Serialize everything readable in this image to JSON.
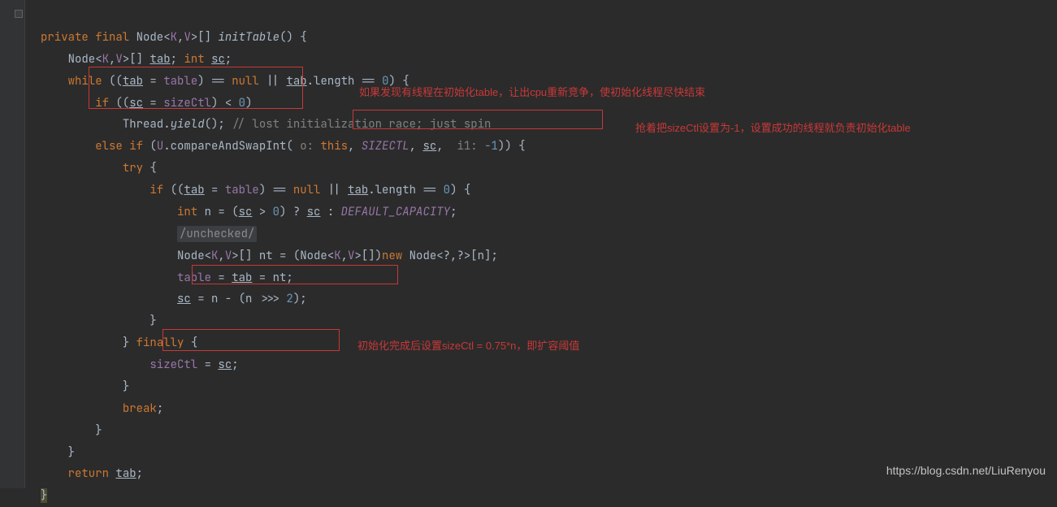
{
  "code": {
    "l1_kw1": "private final",
    "l1_type": "Node",
    "l1_gen": "<K,V>[]",
    "l1_name": "initTable",
    "l1_brace": "() {",
    "l2_a": "Node<",
    "l2_k": "K",
    "l2_m": ",",
    "l2_v": "V",
    "l2_b": ">[] ",
    "l2_tab": "tab",
    "l2_sep": "; ",
    "l2_int": "int ",
    "l2_sc": "sc",
    "l2_end": ";",
    "l3_a": "while ((",
    "l3_tab": "tab",
    "l3_eq": " = ",
    "l3_table": "table",
    "l3_b": ") == ",
    "l3_null": "null",
    "l3_c": " || ",
    "l3_tab2": "tab",
    "l3_len": ".length == ",
    "l3_zero": "0",
    "l3_d": ") {",
    "l4_if": "if ((",
    "l4_sc": "sc",
    "l4_eq": " = ",
    "l4_sctl": "sizeCtl",
    "l4_b": ") < ",
    "l4_zero": "0",
    "l4_end": ")",
    "l5_a": "Thread.",
    "l5_y": "yield",
    "l5_b": "(); ",
    "l5_cmt": "// lost initialization race; just spin",
    "l6_else": "else if ",
    "l6_a": "(",
    "l6_u": "U",
    "l6_m": ".compareAndSwapInt(",
    "l6_p1": " o: ",
    "l6_this": "this",
    "l6_c1": ", ",
    "l6_sctl": "SIZECTL",
    "l6_c2": ", ",
    "l6_sc": "sc",
    "l6_c3": ", ",
    "l6_p2": " i1: ",
    "l6_neg1": "-1",
    "l6_end": ")) {",
    "l7_try": "try {",
    "l8_if": "if ((",
    "l8_tab": "tab",
    "l8_eq": " = ",
    "l8_table": "table",
    "l8_b": ") == ",
    "l8_null": "null",
    "l8_c": " || ",
    "l8_tab2": "tab",
    "l8_len": ".length == ",
    "l8_zero": "0",
    "l8_end": ") {",
    "l9_int": "int ",
    "l9_n": "n = (",
    "l9_sc": "sc",
    "l9_gt": " > ",
    "l9_z": "0",
    "l9_q": ") ? ",
    "l9_sc2": "sc",
    "l9_colon": " : ",
    "l9_dc": "DEFAULT_CAPACITY",
    "l9_end": ";",
    "l10": "/unchecked/",
    "l11_a": "Node<",
    "l11_k": "K",
    "l11_m1": ",",
    "l11_v": "V",
    "l11_b": ">[] nt = (Node<",
    "l11_k2": "K",
    "l11_m2": ",",
    "l11_v2": "V",
    "l11_c": ">[])",
    "l11_new": "new ",
    "l11_d": "Node<?,?>[n];",
    "l12_a": "table",
    "l12_eq": " = ",
    "l12_tab": "tab",
    "l12_eq2": " = nt;",
    "l13_sc": "sc",
    "l13_a": " = n - (n >>> ",
    "l13_two": "2",
    "l13_b": ");",
    "l14": "}",
    "l15_a": "} ",
    "l15_fin": "finally",
    "l15_b": " {",
    "l16_sctl": "sizeCtl",
    "l16_eq": " = ",
    "l16_sc": "sc",
    "l16_end": ";",
    "l17": "}",
    "l18": "break;",
    "l19": "}",
    "l20": "}",
    "l21_ret": "return ",
    "l21_tab": "tab",
    "l21_end": ";",
    "l22": "}"
  },
  "annotations": {
    "a1": "如果发现有线程在初始化table，让出cpu重新竞争，使初始化线程尽快结束",
    "a2": "抢着把sizeCtl设置为-1，设置成功的线程就负责初始化table",
    "a3": "初始化完成后设置sizeCtl = 0.75*n，即扩容阈值"
  },
  "watermark": "https://blog.csdn.net/LiuRenyou"
}
